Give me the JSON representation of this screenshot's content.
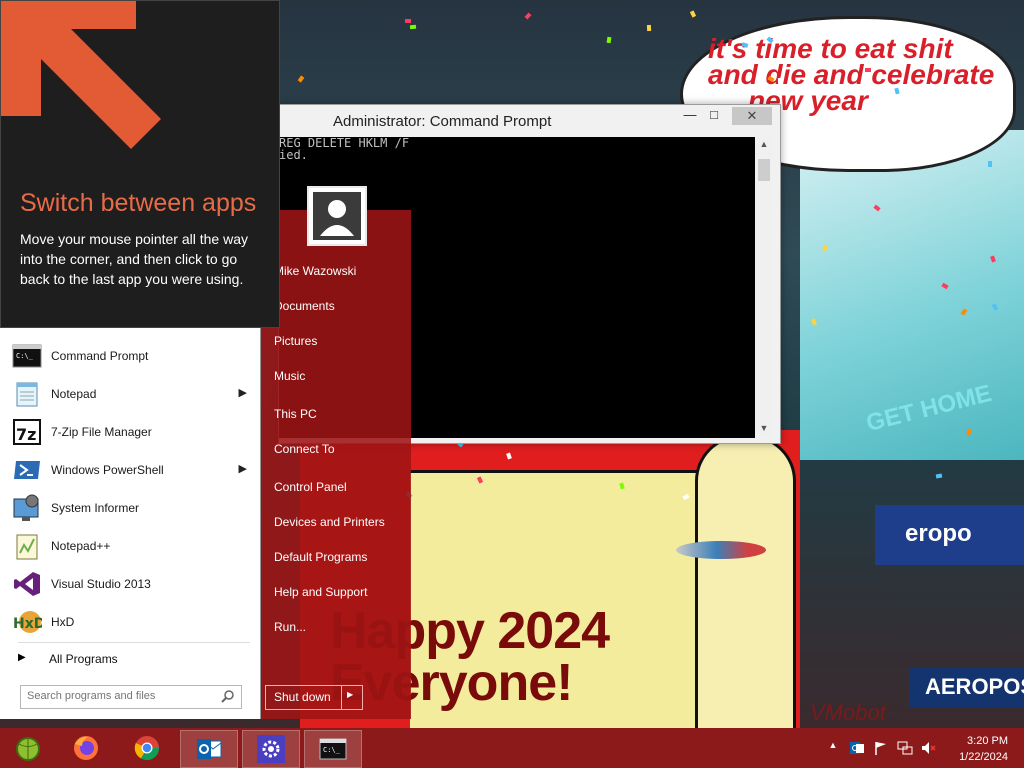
{
  "wallpaper": {
    "bubble_lines": [
      "it's time to eat shit",
      "and die and celebrate",
      "new year"
    ],
    "banner_lines": [
      "Happy 2024",
      "Everyone!"
    ],
    "sign_top": "GET HOME",
    "sign_mid": "eropo",
    "sign_bottom": "AEROPOS",
    "signature": "VMobot"
  },
  "tip": {
    "title": "Switch between apps",
    "body": "Move your mouse pointer all the way into the corner, and then click to go back to the last app you were using.",
    "icon": "orange-arrow-icon"
  },
  "cmd": {
    "title": "Administrator: Command Prompt",
    "lines": [
      "REG DELETE HKLM /F",
      "ied."
    ],
    "buttons": {
      "minimize": "—",
      "maximize": "□",
      "close": "✕"
    }
  },
  "start_menu": {
    "programs": [
      {
        "label": "Command Prompt",
        "icon": "cmd-icon",
        "has_submenu": false
      },
      {
        "label": "Notepad",
        "icon": "notepad-icon",
        "has_submenu": true
      },
      {
        "label": "7-Zip File Manager",
        "icon": "7zip-icon",
        "has_submenu": false
      },
      {
        "label": "Windows PowerShell",
        "icon": "powershell-icon",
        "has_submenu": true
      },
      {
        "label": "System Informer",
        "icon": "system-informer-icon",
        "has_submenu": false
      },
      {
        "label": "Notepad++",
        "icon": "notepadpp-icon",
        "has_submenu": false
      },
      {
        "label": "Visual Studio 2013",
        "icon": "visual-studio-icon",
        "has_submenu": false
      },
      {
        "label": "HxD",
        "icon": "hxd-icon",
        "has_submenu": false
      }
    ],
    "all_programs": "All Programs",
    "search_placeholder": "Search programs and files",
    "user_name": "Mike Wazowski",
    "right_items": [
      "Documents",
      "Pictures",
      "Music",
      "This PC",
      "Connect To",
      "Control Panel",
      "Devices and Printers",
      "Default Programs",
      "Help and Support",
      "Run..."
    ],
    "shutdown": "Shut down"
  },
  "taskbar": {
    "apps": [
      {
        "name": "melon-app",
        "icon": "melon-icon",
        "active": false
      },
      {
        "name": "firefox",
        "icon": "firefox-icon",
        "active": false
      },
      {
        "name": "chrome",
        "icon": "chrome-icon",
        "active": false
      },
      {
        "name": "outlook",
        "icon": "outlook-icon",
        "active": true
      },
      {
        "name": "settings",
        "icon": "settings-gear-icon",
        "active": true
      },
      {
        "name": "command-prompt",
        "icon": "cmd-icon",
        "active": true
      }
    ],
    "tray": [
      "show-hidden-icons-icon",
      "outlook-tray-icon",
      "action-center-flag-icon",
      "network-icon",
      "volume-muted-icon"
    ],
    "time": "3:20 PM",
    "date": "1/22/2024"
  }
}
